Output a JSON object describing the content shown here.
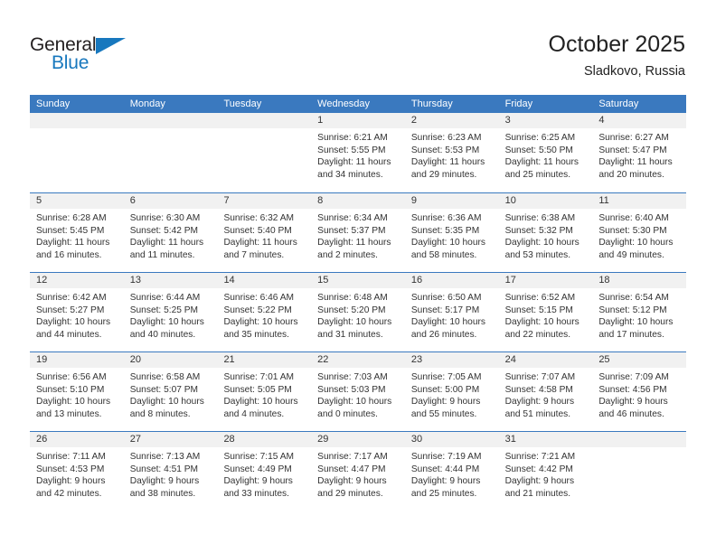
{
  "brand": {
    "name_top": "General",
    "name_bottom": "Blue",
    "accent_color": "#1878be"
  },
  "header": {
    "title": "October 2025",
    "subtitle": "Sladkovo, Russia"
  },
  "calendar": {
    "header_color": "#3a79bf",
    "weekdays": [
      "Sunday",
      "Monday",
      "Tuesday",
      "Wednesday",
      "Thursday",
      "Friday",
      "Saturday"
    ],
    "weeks": [
      [
        {
          "day": "",
          "empty": true
        },
        {
          "day": "",
          "empty": true
        },
        {
          "day": "",
          "empty": true
        },
        {
          "day": "1",
          "sunrise": "Sunrise: 6:21 AM",
          "sunset": "Sunset: 5:55 PM",
          "daylight1": "Daylight: 11 hours",
          "daylight2": "and 34 minutes."
        },
        {
          "day": "2",
          "sunrise": "Sunrise: 6:23 AM",
          "sunset": "Sunset: 5:53 PM",
          "daylight1": "Daylight: 11 hours",
          "daylight2": "and 29 minutes."
        },
        {
          "day": "3",
          "sunrise": "Sunrise: 6:25 AM",
          "sunset": "Sunset: 5:50 PM",
          "daylight1": "Daylight: 11 hours",
          "daylight2": "and 25 minutes."
        },
        {
          "day": "4",
          "sunrise": "Sunrise: 6:27 AM",
          "sunset": "Sunset: 5:47 PM",
          "daylight1": "Daylight: 11 hours",
          "daylight2": "and 20 minutes."
        }
      ],
      [
        {
          "day": "5",
          "sunrise": "Sunrise: 6:28 AM",
          "sunset": "Sunset: 5:45 PM",
          "daylight1": "Daylight: 11 hours",
          "daylight2": "and 16 minutes."
        },
        {
          "day": "6",
          "sunrise": "Sunrise: 6:30 AM",
          "sunset": "Sunset: 5:42 PM",
          "daylight1": "Daylight: 11 hours",
          "daylight2": "and 11 minutes."
        },
        {
          "day": "7",
          "sunrise": "Sunrise: 6:32 AM",
          "sunset": "Sunset: 5:40 PM",
          "daylight1": "Daylight: 11 hours",
          "daylight2": "and 7 minutes."
        },
        {
          "day": "8",
          "sunrise": "Sunrise: 6:34 AM",
          "sunset": "Sunset: 5:37 PM",
          "daylight1": "Daylight: 11 hours",
          "daylight2": "and 2 minutes."
        },
        {
          "day": "9",
          "sunrise": "Sunrise: 6:36 AM",
          "sunset": "Sunset: 5:35 PM",
          "daylight1": "Daylight: 10 hours",
          "daylight2": "and 58 minutes."
        },
        {
          "day": "10",
          "sunrise": "Sunrise: 6:38 AM",
          "sunset": "Sunset: 5:32 PM",
          "daylight1": "Daylight: 10 hours",
          "daylight2": "and 53 minutes."
        },
        {
          "day": "11",
          "sunrise": "Sunrise: 6:40 AM",
          "sunset": "Sunset: 5:30 PM",
          "daylight1": "Daylight: 10 hours",
          "daylight2": "and 49 minutes."
        }
      ],
      [
        {
          "day": "12",
          "sunrise": "Sunrise: 6:42 AM",
          "sunset": "Sunset: 5:27 PM",
          "daylight1": "Daylight: 10 hours",
          "daylight2": "and 44 minutes."
        },
        {
          "day": "13",
          "sunrise": "Sunrise: 6:44 AM",
          "sunset": "Sunset: 5:25 PM",
          "daylight1": "Daylight: 10 hours",
          "daylight2": "and 40 minutes."
        },
        {
          "day": "14",
          "sunrise": "Sunrise: 6:46 AM",
          "sunset": "Sunset: 5:22 PM",
          "daylight1": "Daylight: 10 hours",
          "daylight2": "and 35 minutes."
        },
        {
          "day": "15",
          "sunrise": "Sunrise: 6:48 AM",
          "sunset": "Sunset: 5:20 PM",
          "daylight1": "Daylight: 10 hours",
          "daylight2": "and 31 minutes."
        },
        {
          "day": "16",
          "sunrise": "Sunrise: 6:50 AM",
          "sunset": "Sunset: 5:17 PM",
          "daylight1": "Daylight: 10 hours",
          "daylight2": "and 26 minutes."
        },
        {
          "day": "17",
          "sunrise": "Sunrise: 6:52 AM",
          "sunset": "Sunset: 5:15 PM",
          "daylight1": "Daylight: 10 hours",
          "daylight2": "and 22 minutes."
        },
        {
          "day": "18",
          "sunrise": "Sunrise: 6:54 AM",
          "sunset": "Sunset: 5:12 PM",
          "daylight1": "Daylight: 10 hours",
          "daylight2": "and 17 minutes."
        }
      ],
      [
        {
          "day": "19",
          "sunrise": "Sunrise: 6:56 AM",
          "sunset": "Sunset: 5:10 PM",
          "daylight1": "Daylight: 10 hours",
          "daylight2": "and 13 minutes."
        },
        {
          "day": "20",
          "sunrise": "Sunrise: 6:58 AM",
          "sunset": "Sunset: 5:07 PM",
          "daylight1": "Daylight: 10 hours",
          "daylight2": "and 8 minutes."
        },
        {
          "day": "21",
          "sunrise": "Sunrise: 7:01 AM",
          "sunset": "Sunset: 5:05 PM",
          "daylight1": "Daylight: 10 hours",
          "daylight2": "and 4 minutes."
        },
        {
          "day": "22",
          "sunrise": "Sunrise: 7:03 AM",
          "sunset": "Sunset: 5:03 PM",
          "daylight1": "Daylight: 10 hours",
          "daylight2": "and 0 minutes."
        },
        {
          "day": "23",
          "sunrise": "Sunrise: 7:05 AM",
          "sunset": "Sunset: 5:00 PM",
          "daylight1": "Daylight: 9 hours",
          "daylight2": "and 55 minutes."
        },
        {
          "day": "24",
          "sunrise": "Sunrise: 7:07 AM",
          "sunset": "Sunset: 4:58 PM",
          "daylight1": "Daylight: 9 hours",
          "daylight2": "and 51 minutes."
        },
        {
          "day": "25",
          "sunrise": "Sunrise: 7:09 AM",
          "sunset": "Sunset: 4:56 PM",
          "daylight1": "Daylight: 9 hours",
          "daylight2": "and 46 minutes."
        }
      ],
      [
        {
          "day": "26",
          "sunrise": "Sunrise: 7:11 AM",
          "sunset": "Sunset: 4:53 PM",
          "daylight1": "Daylight: 9 hours",
          "daylight2": "and 42 minutes."
        },
        {
          "day": "27",
          "sunrise": "Sunrise: 7:13 AM",
          "sunset": "Sunset: 4:51 PM",
          "daylight1": "Daylight: 9 hours",
          "daylight2": "and 38 minutes."
        },
        {
          "day": "28",
          "sunrise": "Sunrise: 7:15 AM",
          "sunset": "Sunset: 4:49 PM",
          "daylight1": "Daylight: 9 hours",
          "daylight2": "and 33 minutes."
        },
        {
          "day": "29",
          "sunrise": "Sunrise: 7:17 AM",
          "sunset": "Sunset: 4:47 PM",
          "daylight1": "Daylight: 9 hours",
          "daylight2": "and 29 minutes."
        },
        {
          "day": "30",
          "sunrise": "Sunrise: 7:19 AM",
          "sunset": "Sunset: 4:44 PM",
          "daylight1": "Daylight: 9 hours",
          "daylight2": "and 25 minutes."
        },
        {
          "day": "31",
          "sunrise": "Sunrise: 7:21 AM",
          "sunset": "Sunset: 4:42 PM",
          "daylight1": "Daylight: 9 hours",
          "daylight2": "and 21 minutes."
        },
        {
          "day": "",
          "empty": true
        }
      ]
    ]
  }
}
